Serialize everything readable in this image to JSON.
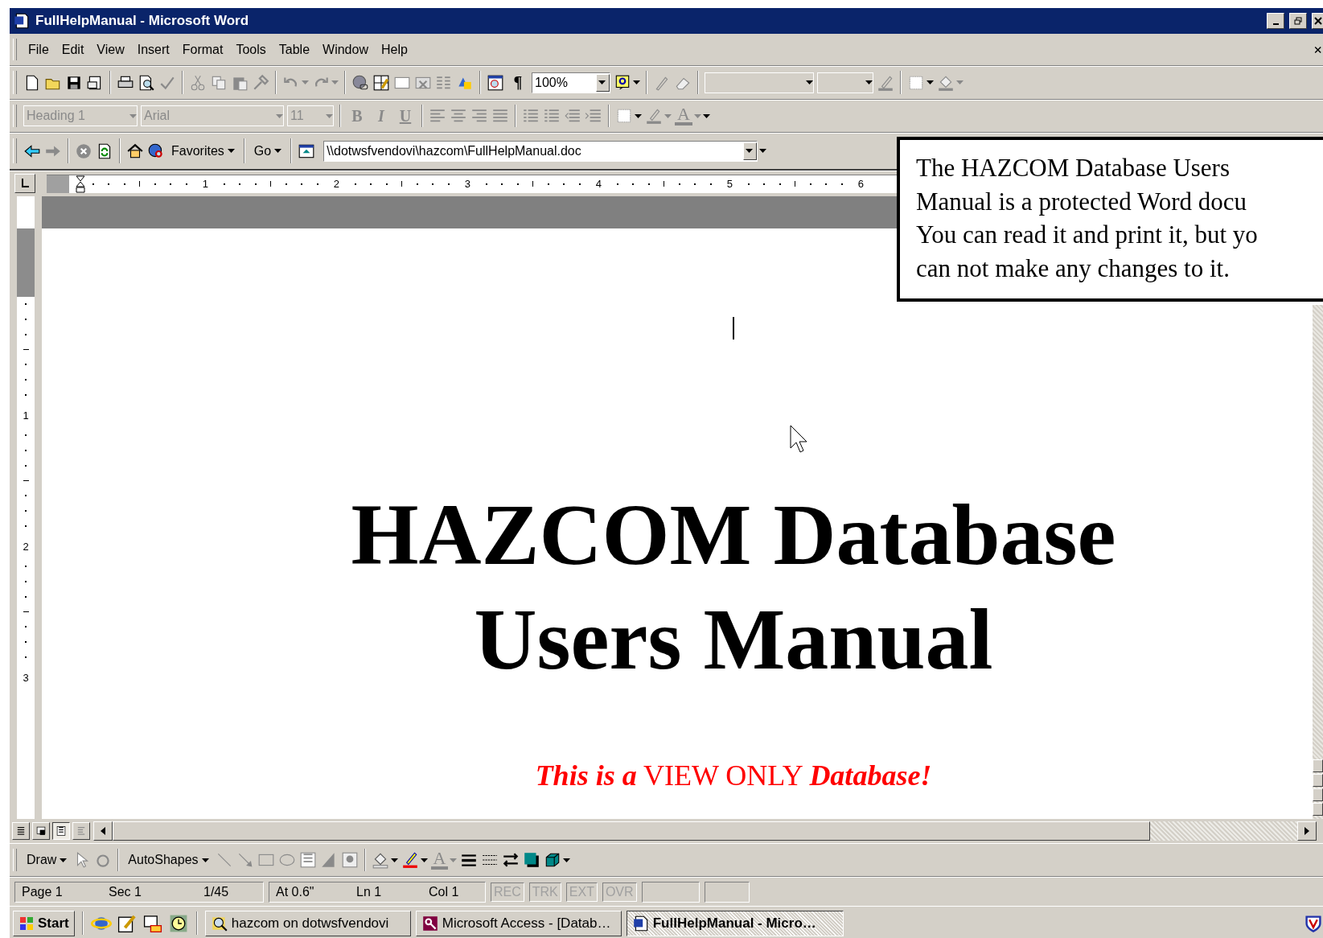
{
  "window": {
    "title": "FullHelpManual - Microsoft Word"
  },
  "menu": [
    "File",
    "Edit",
    "View",
    "Insert",
    "Format",
    "Tools",
    "Table",
    "Window",
    "Help"
  ],
  "standard_toolbar": {
    "pilcrow": "¶",
    "zoom": "100%"
  },
  "formatting_toolbar": {
    "disabled": true,
    "style": "Heading 1",
    "font": "Arial",
    "size": "11",
    "bold": "B",
    "italic": "I",
    "underline": "U",
    "font_color": "A"
  },
  "web_toolbar": {
    "favorites": "Favorites",
    "go": "Go",
    "address": "\\\\dotwsfvendovi\\hazcom\\FullHelpManual.doc"
  },
  "ruler": {
    "marks": [
      "1",
      "2",
      "3",
      "4",
      "5",
      "6"
    ]
  },
  "vertical_ruler": {
    "marks": [
      "1",
      "2",
      "3"
    ]
  },
  "callout": {
    "lines": [
      "The HAZCOM Database Users",
      "Manual is a protected Word docu",
      "You can read it and print it, but yo",
      "can not make any changes to it."
    ]
  },
  "document": {
    "heading": [
      "HAZCOM Database",
      "Users Manual"
    ],
    "notice": "*This is a* VIEW ONLY *Database!*"
  },
  "view_buttons": [
    {
      "kind": "normal",
      "selected": false
    },
    {
      "kind": "web",
      "selected": false
    },
    {
      "kind": "print",
      "selected": true
    },
    {
      "kind": "outline",
      "selected": false
    }
  ],
  "draw_toolbar": {
    "draw": "Draw",
    "autoshapes": "AutoShapes",
    "font_color": "A"
  },
  "status_bar": {
    "fields": [
      "Page 1",
      "Sec 1",
      "1/45",
      "At 0.6\"",
      "Ln 1",
      "Col 1"
    ],
    "modes": [
      {
        "label": "REC",
        "on": false
      },
      {
        "label": "TRK",
        "on": false
      },
      {
        "label": "EXT",
        "on": false
      },
      {
        "label": "OVR",
        "on": false
      }
    ]
  },
  "taskbar": {
    "start": "Start",
    "tasks": [
      {
        "label": "hazcom on dotwsfvendovi",
        "kind": "search",
        "selected": false
      },
      {
        "label": "Microsoft Access - [Datab…",
        "kind": "access",
        "selected": false
      },
      {
        "label": "FullHelpManual - Micro…",
        "kind": "word",
        "selected": true
      }
    ]
  }
}
